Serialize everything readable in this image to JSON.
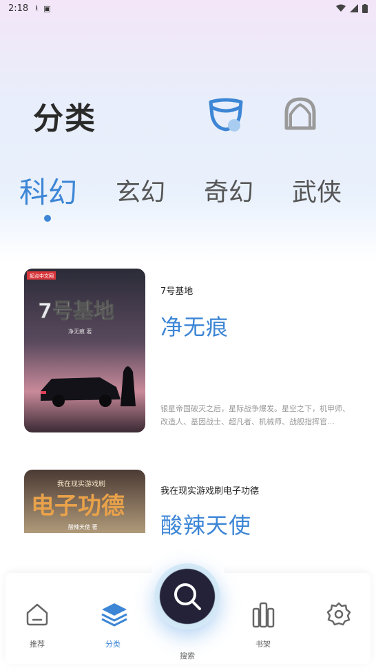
{
  "status_bar": {
    "time": "2:18",
    "icons": [
      "download-icon",
      "a-icon",
      "wifi-icon",
      "signal-icon",
      "battery-icon"
    ]
  },
  "header": {
    "title": "分类",
    "icons": [
      "mask-icon",
      "face-icon"
    ]
  },
  "tabs": [
    {
      "label": "科幻",
      "active": true
    },
    {
      "label": "玄幻",
      "active": false
    },
    {
      "label": "奇幻",
      "active": false
    },
    {
      "label": "武侠",
      "active": false
    }
  ],
  "books": [
    {
      "name": "7号基地",
      "author": "净无痕",
      "description": "银星帝国破灭之后，星际战争爆发。星空之下，机甲师、改造人、基因战士、超凡者、机械师、战舰指挥官…",
      "cover": {
        "title": "7号基地",
        "subtitle": "净无痕 著",
        "publisher": "起点中文网"
      }
    },
    {
      "name": "我在现实游戏刷电子功德",
      "author": "酸辣天使",
      "description": "",
      "cover": {
        "title": "电子功德",
        "subtitle": "我在现实游戏刷",
        "byline": "酸辣天使 著"
      }
    }
  ],
  "bottom_nav": {
    "items": [
      {
        "label": "推荐",
        "icon": "home-icon",
        "active": false
      },
      {
        "label": "分类",
        "icon": "layers-icon",
        "active": true
      },
      {
        "label": "书架",
        "icon": "bookshelf-icon",
        "active": false
      },
      {
        "label": "",
        "icon": "gear-icon",
        "active": false
      }
    ],
    "search_label": "搜索"
  },
  "colors": {
    "accent": "#3d86d6",
    "dark": "#232238"
  }
}
